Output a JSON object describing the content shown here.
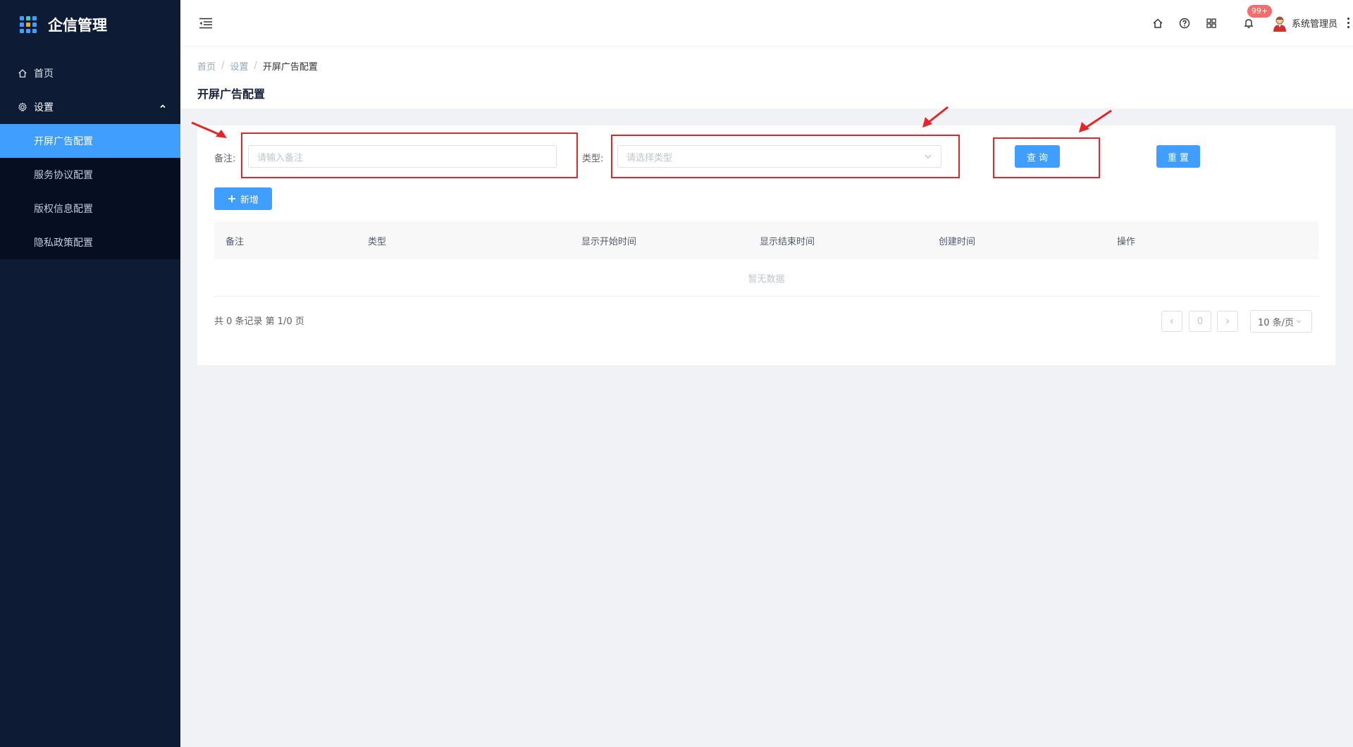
{
  "app": {
    "title": "企信管理"
  },
  "sidebar": {
    "items": [
      {
        "label": "首页",
        "icon": "home-icon"
      },
      {
        "label": "设置",
        "icon": "gear-icon",
        "expanded": true,
        "children": [
          {
            "label": "开屏广告配置",
            "active": true
          },
          {
            "label": "服务协议配置"
          },
          {
            "label": "版权信息配置"
          },
          {
            "label": "隐私政策配置"
          }
        ]
      }
    ]
  },
  "header": {
    "notification_badge": "99+",
    "username": "系统管理员"
  },
  "breadcrumb": [
    "首页",
    "设置",
    "开屏广告配置"
  ],
  "page_title": "开屏广告配置",
  "filters": {
    "remark_label": "备注:",
    "remark_placeholder": "请输入备注",
    "type_label": "类型:",
    "type_placeholder": "请选择类型",
    "query_button": "查 询",
    "reset_button": "重 置"
  },
  "toolbar": {
    "add_button": "新增"
  },
  "table": {
    "columns": [
      "备注",
      "类型",
      "显示开始时间",
      "显示结束时间",
      "创建时间",
      "操作"
    ],
    "empty_text": "暂无数据"
  },
  "pagination": {
    "summary": "共 0 条记录 第 1/0 页",
    "current_page": "0",
    "page_size": "10 条/页"
  },
  "colors": {
    "sidebar_bg": "#0d1b35",
    "primary": "#409eff",
    "annotation_red": "#e3262a"
  }
}
